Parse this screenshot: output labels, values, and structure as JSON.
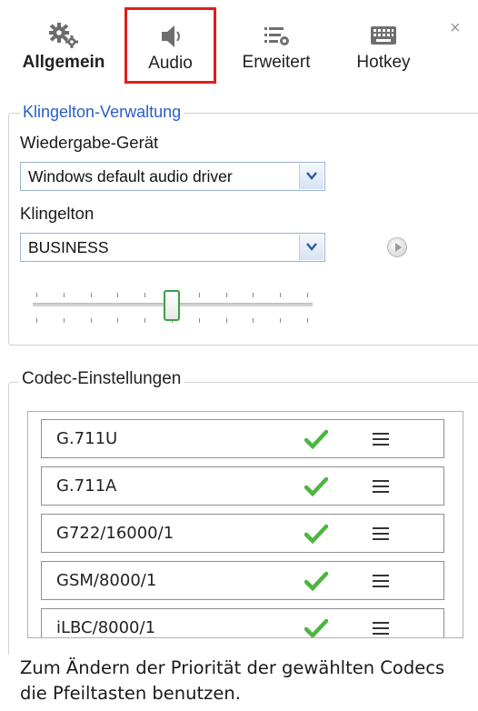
{
  "tabs": [
    {
      "label": "Allgemein",
      "icon": "gears-icon",
      "active": true
    },
    {
      "label": "Audio",
      "icon": "speaker-icon",
      "highlighted": true
    },
    {
      "label": "Erweitert",
      "icon": "list-settings-icon"
    },
    {
      "label": "Hotkey",
      "icon": "keyboard-icon"
    }
  ],
  "close_label": "×",
  "ringtone_group": {
    "legend": "Klingelton-Verwaltung",
    "playback_label": "Wiedergabe-Gerät",
    "playback_value": "Windows default audio driver",
    "ringtone_label": "Klingelton",
    "ringtone_value": "BUSINESS",
    "volume_level": 0.5
  },
  "codec_group": {
    "legend": "Codec-Einstellungen",
    "codecs": [
      {
        "name": "G.711U",
        "enabled": true
      },
      {
        "name": "G.711A",
        "enabled": true
      },
      {
        "name": "G722/16000/1",
        "enabled": true
      },
      {
        "name": "GSM/8000/1",
        "enabled": true
      },
      {
        "name": "iLBC/8000/1",
        "enabled": true
      }
    ]
  },
  "note": "Zum Ändern der Priorität der gewählten Codecs die Pfeiltasten benutzen.",
  "colors": {
    "highlight_border": "#e21d1d",
    "legend_blue": "#2a5ec9",
    "check_green": "#4cb640",
    "slider_thumb_border": "#3aa045"
  }
}
